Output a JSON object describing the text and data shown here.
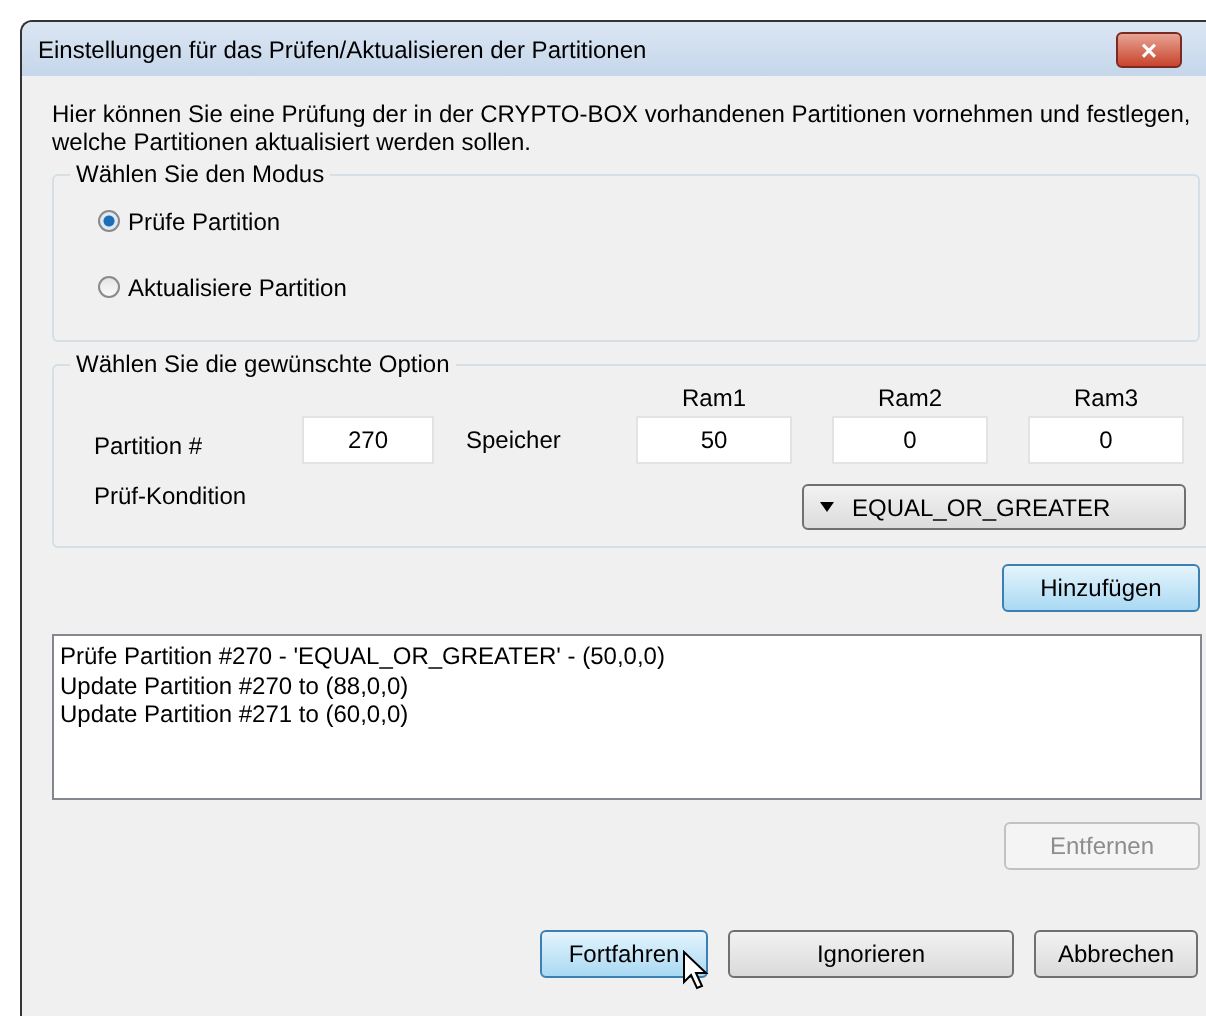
{
  "window": {
    "title": "Einstellungen für das Prüfen/Aktualisieren der Partitionen",
    "close": "×"
  },
  "intro": "Hier können Sie eine Prüfung der in der CRYPTO-BOX vorhandenen Partitionen vornehmen und festlegen, welche Partitionen aktualisiert werden sollen.",
  "mode_group": {
    "title": "Wählen Sie den Modus",
    "options": [
      {
        "label": "Prüfe Partition",
        "selected": true
      },
      {
        "label": "Aktualisiere Partition",
        "selected": false
      }
    ]
  },
  "option_group": {
    "title": "Wählen Sie die gewünschte Option",
    "partition_label": "Partition #",
    "partition_value": "270",
    "memory_label": "Speicher",
    "rams": [
      {
        "label": "Ram1",
        "value": "50"
      },
      {
        "label": "Ram2",
        "value": "0"
      },
      {
        "label": "Ram3",
        "value": "0"
      }
    ],
    "condition_label": "Prüf-Kondition",
    "condition_value": "EQUAL_OR_GREATER"
  },
  "add_button": {
    "label": "Hinzufügen",
    "highlighted": true,
    "disabled": false
  },
  "entries": [
    "Prüfe Partition #270 - 'EQUAL_OR_GREATER' - (50,0,0)",
    "Update Partition #270 to (88,0,0)",
    "Update Partition #271 to (60,0,0)"
  ],
  "remove_button": {
    "label": "Entfernen",
    "highlighted": false,
    "disabled": true
  },
  "buttons": [
    {
      "label": "Fortfahren",
      "highlighted": true,
      "disabled": false
    },
    {
      "label": "Ignorieren",
      "highlighted": false,
      "disabled": false
    },
    {
      "label": "Abbrechen",
      "highlighted": false,
      "disabled": false
    }
  ]
}
